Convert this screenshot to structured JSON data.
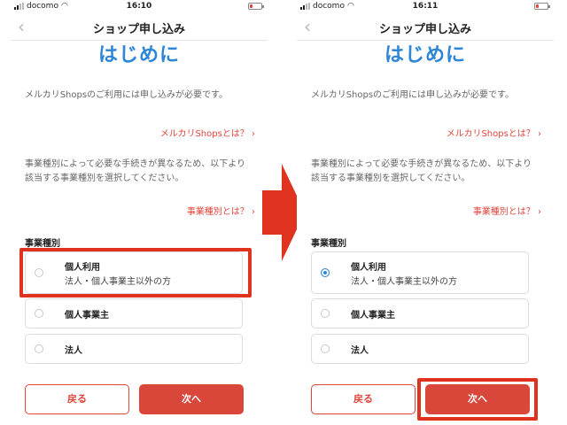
{
  "colors": {
    "accent_red": "#e0453a",
    "accent_blue": "#2e86d6",
    "highlight": "#e0331f"
  },
  "screens": [
    {
      "status": {
        "carrier": "docomo",
        "time": "16:10"
      },
      "nav": {
        "back_icon": "chevron-left-icon",
        "title": "ショップ申し込み"
      },
      "hero": "はじめに",
      "intro": "メルカリShopsのご利用には申し込みが必要です。",
      "link_shops": "メルカリShopsとは？ ›",
      "business_note": "事業種別によって必要な手続きが異なるため、以下より該当する事業種別を選択してください。",
      "link_business": "事業種別とは？ ›",
      "section_label": "事業種別",
      "options": [
        {
          "title": "個人利用",
          "subtitle": "法人・個人事業主以外の方",
          "selected": false
        },
        {
          "title": "個人事業主",
          "selected": false
        },
        {
          "title": "法人",
          "selected": false
        }
      ],
      "back_button": "戻る",
      "next_button": "次へ"
    },
    {
      "status": {
        "carrier": "docomo",
        "time": "16:11"
      },
      "nav": {
        "back_icon": "chevron-left-icon",
        "title": "ショップ申し込み"
      },
      "hero": "はじめに",
      "intro": "メルカリShopsのご利用には申し込みが必要です。",
      "link_shops": "メルカリShopsとは？ ›",
      "business_note": "事業種別によって必要な手続きが異なるため、以下より該当する事業種別を選択してください。",
      "link_business": "事業種別とは？ ›",
      "section_label": "事業種別",
      "options": [
        {
          "title": "個人利用",
          "subtitle": "法人・個人事業主以外の方",
          "selected": true
        },
        {
          "title": "個人事業主",
          "selected": false
        },
        {
          "title": "法人",
          "selected": false
        }
      ],
      "back_button": "戻る",
      "next_button": "次へ"
    }
  ]
}
